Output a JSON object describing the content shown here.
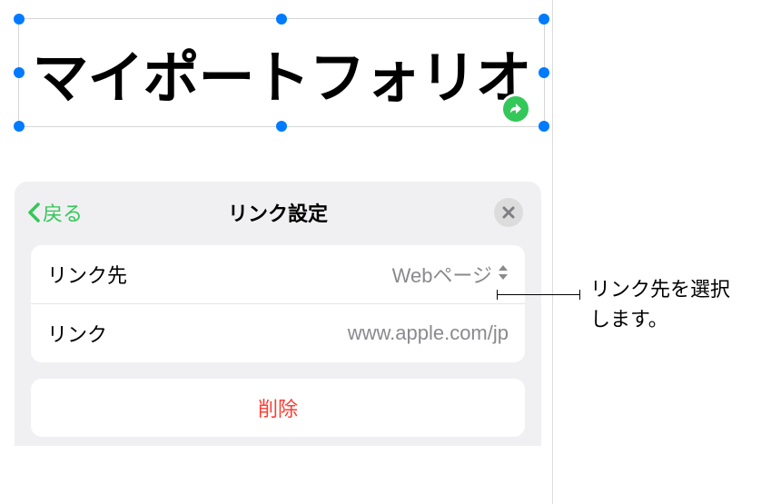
{
  "text_box": {
    "content": "マイポートフォリオ"
  },
  "popover": {
    "back_label": "戻る",
    "title": "リンク設定",
    "rows": {
      "link_to": {
        "label": "リンク先",
        "value": "Webページ"
      },
      "link": {
        "label": "リンク",
        "value": "www.apple.com/jp"
      }
    },
    "delete_label": "削除"
  },
  "callout": {
    "line1": "リンク先を選択",
    "line2": "します。"
  }
}
